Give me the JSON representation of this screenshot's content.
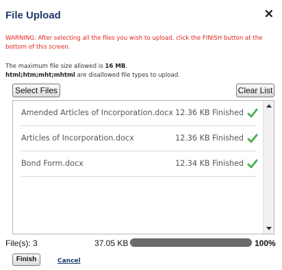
{
  "dialog": {
    "title": "File Upload",
    "close_icon": "close-icon",
    "close_glyph": "✕"
  },
  "warning": "WARNING: After selecting all the files you wish to upload, click the FINISH button at the bottom of this screen.",
  "info": {
    "max_size_prefix": "The maximum file size allowed is ",
    "max_size_value": "16 MB",
    "max_size_suffix": ".",
    "disallowed_types": "html;htm;mht;mhtml",
    "disallowed_suffix": " are disallowed file types to upload."
  },
  "toolbar": {
    "select_files_label": "Select Files",
    "clear_list_label": "Clear List"
  },
  "files": [
    {
      "name": "Amended Articles of Incorporation.docx",
      "size": "12.36 KB",
      "status": "Finished"
    },
    {
      "name": "Articles of Incorporation.docx",
      "size": "12.36 KB",
      "status": "Finished"
    },
    {
      "name": "Bond Form.docx",
      "size": "12.34 KB",
      "status": "Finished"
    }
  ],
  "colors": {
    "title": "#1d3a6b",
    "warning": "#e2231a",
    "check": "#4caf50"
  },
  "footer": {
    "count_label": "File(s): 3",
    "total_size": "37.05 KB",
    "progress_percent": 100,
    "progress_label": "100%",
    "finish_label": "Finish",
    "cancel_label": "Cancel"
  }
}
